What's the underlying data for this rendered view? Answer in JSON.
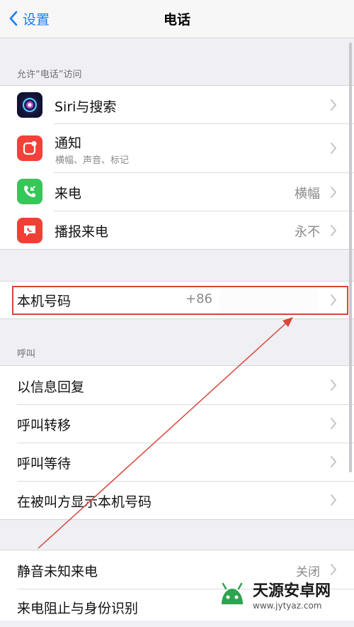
{
  "navbar": {
    "back_label": "设置",
    "title": "电话"
  },
  "sections": {
    "allow_access_header": "允许“电话”访问",
    "call_header": "呼叫"
  },
  "access_items": [
    {
      "label": "Siri与搜索",
      "icon": "siri-icon"
    },
    {
      "label": "通知",
      "sublabel": "横幅、声音、标记",
      "icon": "notifications-icon"
    },
    {
      "label": "来电",
      "value": "横幅",
      "icon": "incoming-call-icon"
    },
    {
      "label": "播报来电",
      "value": "永不",
      "icon": "announce-calls-icon"
    }
  ],
  "my_number": {
    "label": "本机号码",
    "value": "+86"
  },
  "call_items": [
    {
      "label": "以信息回复"
    },
    {
      "label": "呼叫转移"
    },
    {
      "label": "呼叫等待"
    },
    {
      "label": "在被叫方显示本机号码"
    }
  ],
  "bottom_items": [
    {
      "label": "静音未知来电",
      "value": "关闭"
    },
    {
      "label": "来电阻止与身份识别"
    }
  ],
  "watermark": {
    "title": "天源安卓网",
    "subtitle": "www.jytyaz.com"
  },
  "colors": {
    "accent": "#1a7cf5",
    "highlight_box": "#d9453a",
    "arrow": "#d9453a",
    "notifications_icon": "#f2413a",
    "incoming_call_icon": "#35c759",
    "announce_icon": "#ef4036"
  }
}
